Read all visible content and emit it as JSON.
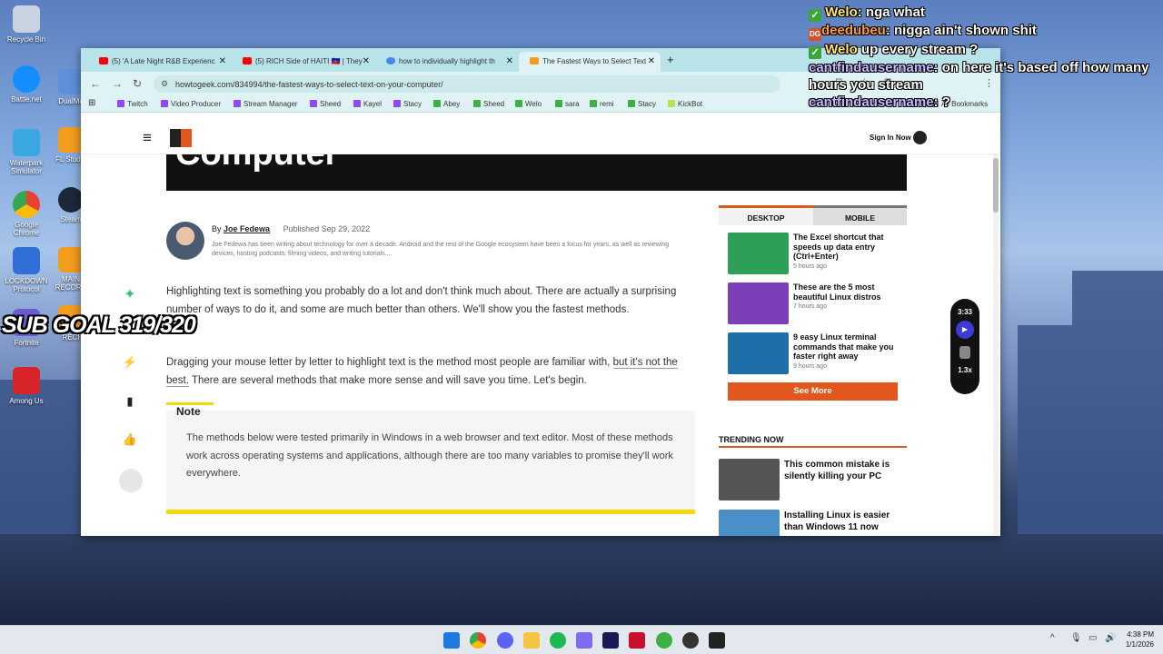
{
  "desktop": {
    "icons": [
      {
        "label": "Recycle Bin",
        "icon": "recycle-bin-icon",
        "color": "#c8d2e0"
      },
      {
        "label": "Battle.net",
        "icon": "battlenet-icon",
        "color": "#148eff"
      },
      {
        "label": "Waterpark Simulator",
        "icon": "game-icon",
        "color": "#39a7e0"
      },
      {
        "label": "Google Chrome",
        "icon": "chrome-icon",
        "color": "#e94235"
      },
      {
        "label": "LOCKDOWN Protocol",
        "icon": "game-icon",
        "color": "#2f6fd6"
      },
      {
        "label": "Fortnite",
        "icon": "game-icon",
        "color": "#6b5bd2"
      },
      {
        "label": "Among Us",
        "icon": "among-us-icon",
        "color": "#d8232a"
      }
    ],
    "icons2": [
      {
        "label": "DualMo",
        "color": "#5e8fd8"
      },
      {
        "label": "FL Studio",
        "color": "#f29d1e"
      },
      {
        "label": "Steam",
        "color": "#1b2838"
      },
      {
        "label": "MAIN RECORD",
        "color": "#f29d1e"
      },
      {
        "label": "RECI",
        "color": "#f29d1e"
      }
    ]
  },
  "overlay": {
    "chat": [
      {
        "user": "Welo",
        "text": "nga what",
        "badge": "✓"
      },
      {
        "user": "deedubeu",
        "text": "nigga ain't shown shit",
        "badge": "DG"
      },
      {
        "user": "Welo",
        "text": "up every stream ?",
        "badge": "✓"
      },
      {
        "user": "cantfindausername",
        "text": "on here it's based off how many hours you stream"
      },
      {
        "user": "cantfindausername",
        "text": "?"
      }
    ],
    "sub_goal": "SUB GOAL 319/320"
  },
  "browser": {
    "tabs": [
      {
        "title": "(5) 'A Late Night R&B Experienc",
        "color": "#ff0000"
      },
      {
        "title": "(5) RICH Side of HAITI 🇭🇹 | They",
        "color": "#ff0000"
      },
      {
        "title": "how to individually highlight th",
        "color": "#4285f4"
      },
      {
        "title": "The Fastest Ways to Select Text",
        "color": "#f59b1e"
      }
    ],
    "new_tab": "+",
    "url": "howtogeek.com/834994/the-fastest-ways-to-select-text-on-your-computer/",
    "bookmarks": [
      {
        "label": "Twitch",
        "color": "#9146ff"
      },
      {
        "label": "Video Producer",
        "color": "#9146ff"
      },
      {
        "label": "Stream Manager",
        "color": "#9146ff"
      },
      {
        "label": "Sheed",
        "color": "#9146ff"
      },
      {
        "label": "Kayel",
        "color": "#9146ff"
      },
      {
        "label": "Stacy",
        "color": "#9146ff"
      },
      {
        "label": "Abey",
        "color": "#3cb043"
      },
      {
        "label": "Sheed",
        "color": "#3cb043"
      },
      {
        "label": "Welo",
        "color": "#3cb043"
      },
      {
        "label": "sara",
        "color": "#3cb043"
      },
      {
        "label": "remi",
        "color": "#3cb043"
      },
      {
        "label": "Stacy",
        "color": "#3cb043"
      },
      {
        "label": "KickBot",
        "color": "#b7e34b"
      }
    ],
    "all_bookmarks": "All Bookmarks"
  },
  "site": {
    "sign_in": "Sign In Now",
    "hero_title": "Computer",
    "author_by": "By",
    "author": "Joe Fedewa",
    "published": "Published Sep 29, 2022",
    "author_bio": "Joe Fedewa has been writing about technology for over a decade. Android and the rest of the Google ecosystem have been a focus for years, as well as reviewing devices, hosting podcasts, filming videos, and writing tutorials....",
    "para1": "Highlighting text is something you probably do a lot and don't think much about. There are actually a surprising number of ways to do it, and some are much better than others. We'll show you the fastest methods.",
    "para2_a": "Dragging your mouse letter by letter to highlight text is the method most people are familiar with,",
    "para2_link": "but it's not the best.",
    "para2_b": "There are several methods that make more sense and will save you time. Let's begin.",
    "note_label": "Note",
    "note_text": "The methods below were tested primarily in Windows in a web browser and text editor. Most of these methods work across operating systems and applications, although there are too many variables to promise they'll work everywhere.",
    "sidebar": {
      "tab_desktop": "DESKTOP",
      "tab_mobile": "MOBILE",
      "items": [
        {
          "title": "The Excel shortcut that speeds up data entry (Ctrl+Enter)",
          "time": "5 hours ago",
          "color": "#2f9e57"
        },
        {
          "title": "These are the 5 most beautiful Linux distros",
          "time": "7 hours ago",
          "color": "#7d3fb8"
        },
        {
          "title": "9 easy Linux terminal commands that make you faster right away",
          "time": "9 hours ago",
          "color": "#1e6fa8"
        }
      ],
      "see_more": "See More",
      "trending_label": "TRENDING NOW",
      "trending": [
        {
          "title": "This common mistake is silently killing your PC",
          "color": "#555"
        },
        {
          "title": "Installing Linux is easier than Windows 11 now",
          "color": "#4b8fc8"
        }
      ]
    },
    "video": {
      "time": "3:33",
      "speed": "1.3x"
    }
  },
  "taskbar": {
    "time": "4:38 PM",
    "date": "1/1/2026"
  },
  "colors": {
    "accent": "#e2571e",
    "note_bar": "#f5d90a"
  }
}
